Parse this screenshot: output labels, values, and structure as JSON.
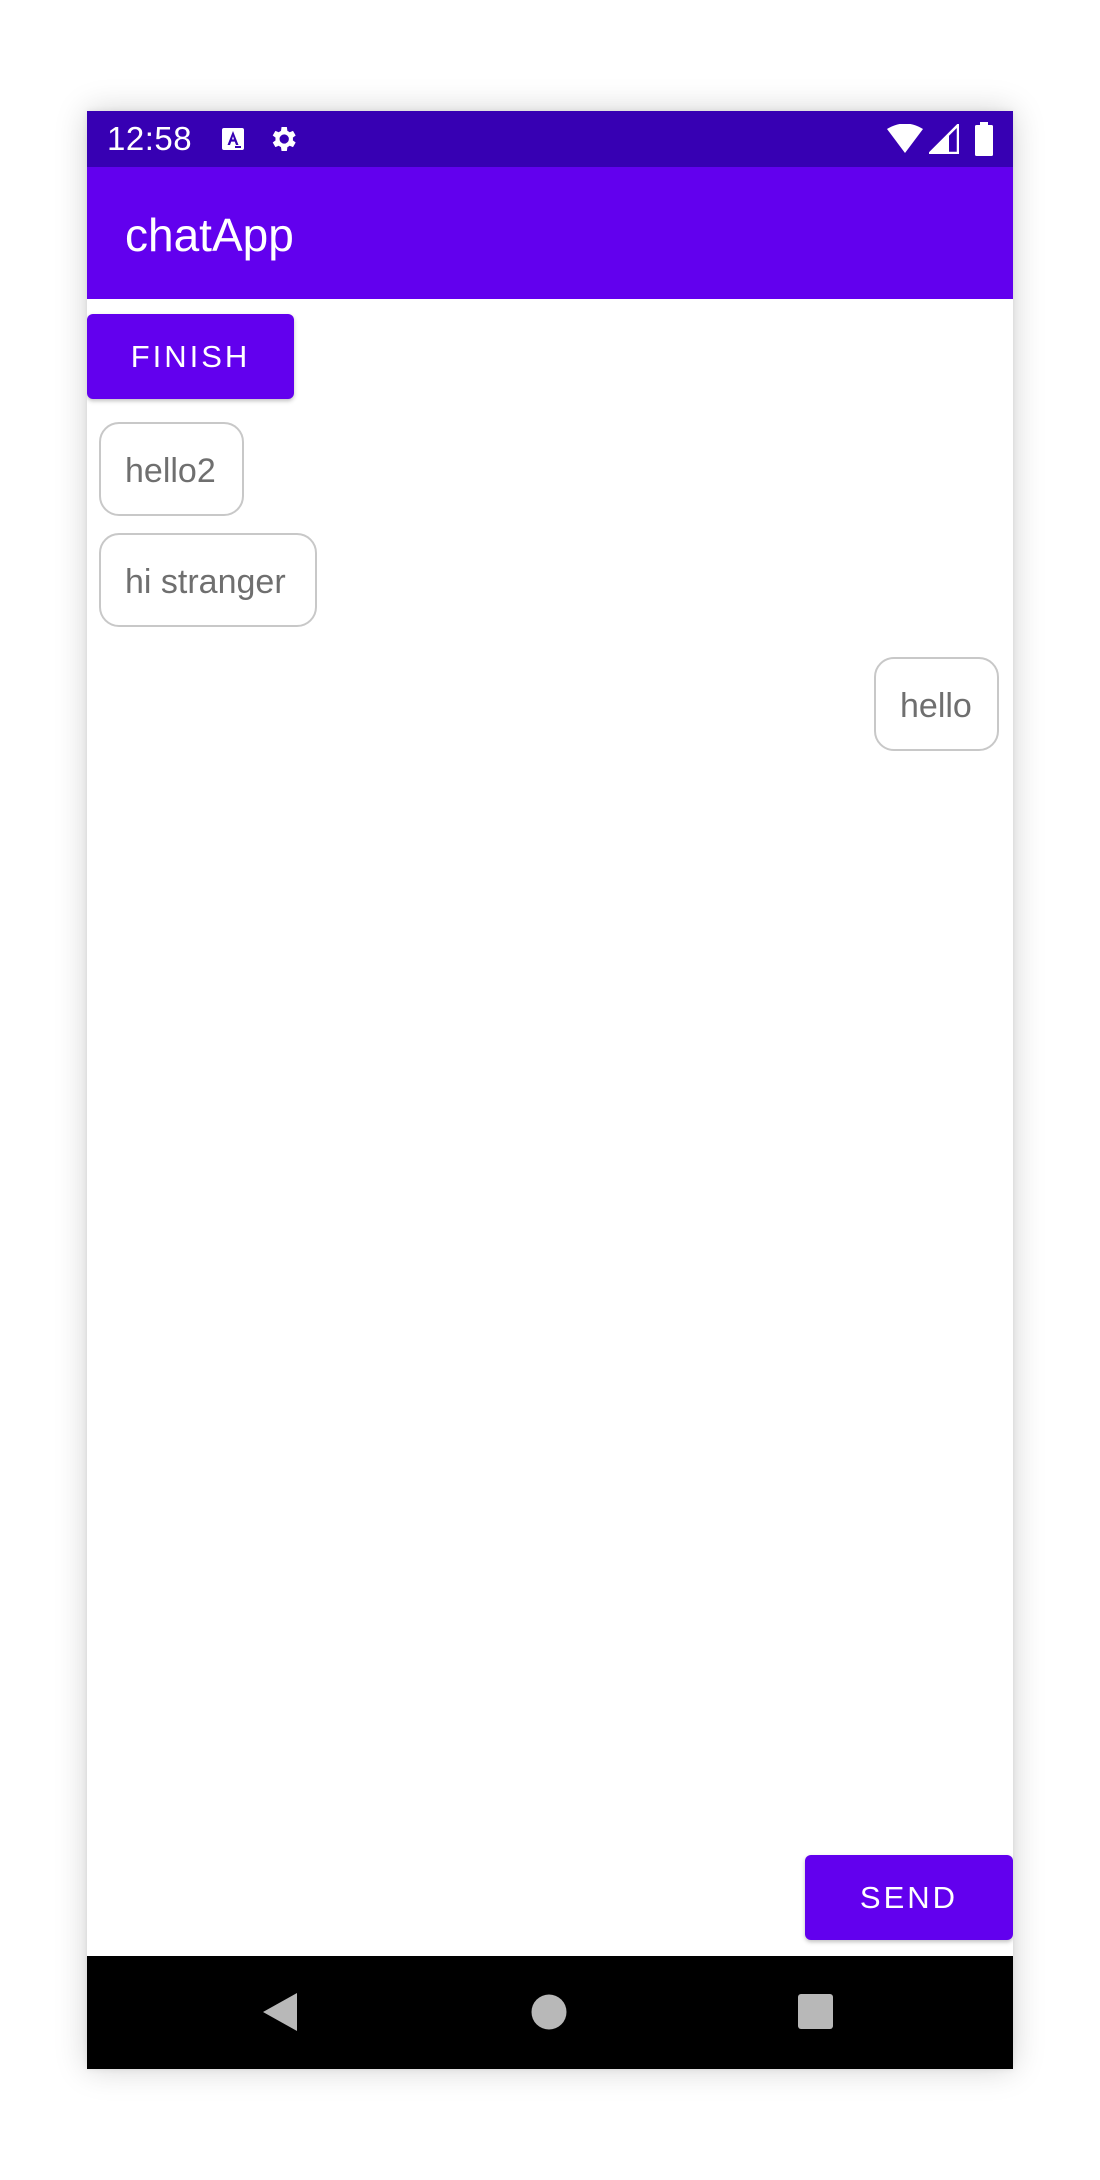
{
  "status_bar": {
    "time": "12:58",
    "icons": [
      "text-a-icon",
      "gear-icon",
      "wifi-icon",
      "signal-icon",
      "battery-icon"
    ]
  },
  "app_bar": {
    "title": "chatApp"
  },
  "buttons": {
    "finish_label": "FINISH",
    "send_label": "SEND"
  },
  "messages": [
    {
      "text": "hello2",
      "side": "left"
    },
    {
      "text": "hi stranger",
      "side": "left"
    },
    {
      "text": "hello",
      "side": "right"
    }
  ],
  "input": {
    "value": "",
    "placeholder": ""
  },
  "nav_bar": {
    "icons": [
      "back-icon",
      "home-icon",
      "recents-icon"
    ]
  },
  "colors": {
    "status_bar": "#3700b3",
    "primary": "#6200ee",
    "input_underline": "#1fd0cc",
    "bubble_border": "#c8c8c8",
    "bubble_text": "#6f6f6f",
    "nav_bar": "#000000"
  }
}
